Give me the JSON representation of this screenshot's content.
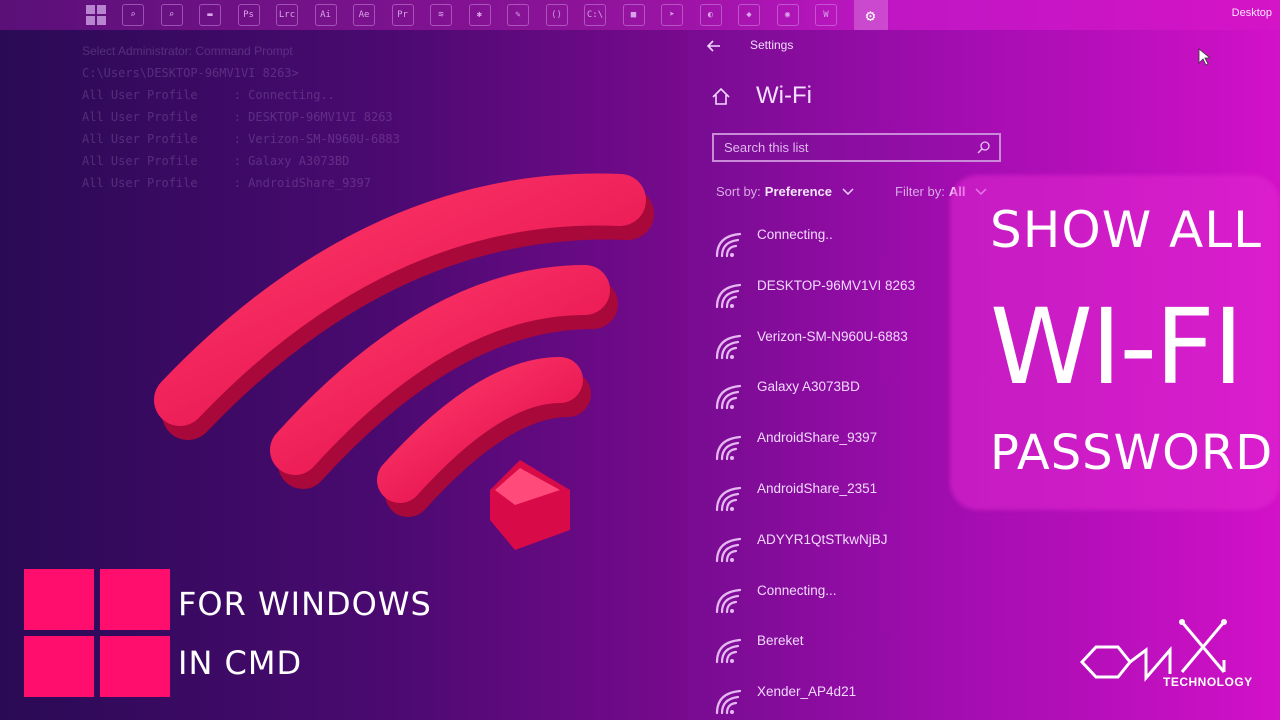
{
  "taskbar": {
    "desktop_label": "Desktop",
    "icons": [
      {
        "name": "search-icon",
        "glyph": "⌕"
      },
      {
        "name": "search-icon-2",
        "glyph": "⌕"
      },
      {
        "name": "folder-icon",
        "glyph": "▬"
      },
      {
        "name": "photoshop-icon",
        "glyph": "Ps"
      },
      {
        "name": "lightroom-icon",
        "glyph": "Lrc"
      },
      {
        "name": "illustrator-icon",
        "glyph": "Ai"
      },
      {
        "name": "after-effects-icon",
        "glyph": "Ae"
      },
      {
        "name": "premiere-icon",
        "glyph": "Pr"
      },
      {
        "name": "app-icon",
        "glyph": "≋"
      },
      {
        "name": "bug-icon",
        "glyph": "✱"
      },
      {
        "name": "chat-icon",
        "glyph": "✎"
      },
      {
        "name": "vscode-icon",
        "glyph": "⟨⟩"
      },
      {
        "name": "terminal-icon",
        "glyph": "C:\\"
      },
      {
        "name": "camera-icon",
        "glyph": "■"
      },
      {
        "name": "telegram-icon",
        "glyph": "➤"
      },
      {
        "name": "edge-icon",
        "glyph": "◐"
      },
      {
        "name": "vpn-icon",
        "glyph": "◆"
      },
      {
        "name": "media-icon",
        "glyph": "◉"
      },
      {
        "name": "word-icon",
        "glyph": "W"
      },
      {
        "name": "settings-gear-icon",
        "glyph": "⚙"
      }
    ]
  },
  "cmd_window": {
    "title": "Select Administrator: Command Prompt",
    "lines": [
      "C:\\Users\\DESKTOP-96MV1VI 8263>",
      "All User Profile     : Connecting..",
      "All User Profile     : DESKTOP-96MV1VI 8263",
      "All User Profile     : Verizon-SM-N960U-6883",
      "All User Profile     : Galaxy A3073BD",
      "All User Profile     : AndroidShare_9397"
    ]
  },
  "settings": {
    "window_title": "Settings",
    "page_title": "Wi-Fi",
    "search_placeholder": "Search this list",
    "sort_label": "Sort by:",
    "sort_value": "Preference",
    "filter_label": "Filter by:",
    "filter_value": "All",
    "networks": [
      "Connecting..",
      "DESKTOP-96MV1VI 8263",
      "Verizon-SM-N960U-6883",
      "Galaxy A3073BD",
      "AndroidShare_9397",
      "AndroidShare_2351",
      "ADYYR1QtSTkwNjBJ",
      "Connecting...",
      "Bereket",
      "Xender_AP4d21"
    ]
  },
  "overlay": {
    "line1": "SHOW ALL",
    "line2": "WI-FI",
    "line3": "PASSWORD",
    "subline1": "FOR WINDOWS",
    "subline2": "IN CMD",
    "brand": "TECHNOLOGY"
  },
  "colors": {
    "accent_pink": "#ff0e6e",
    "wifi_red": "#ff1f5a",
    "panel_purple": "#8c1398"
  }
}
